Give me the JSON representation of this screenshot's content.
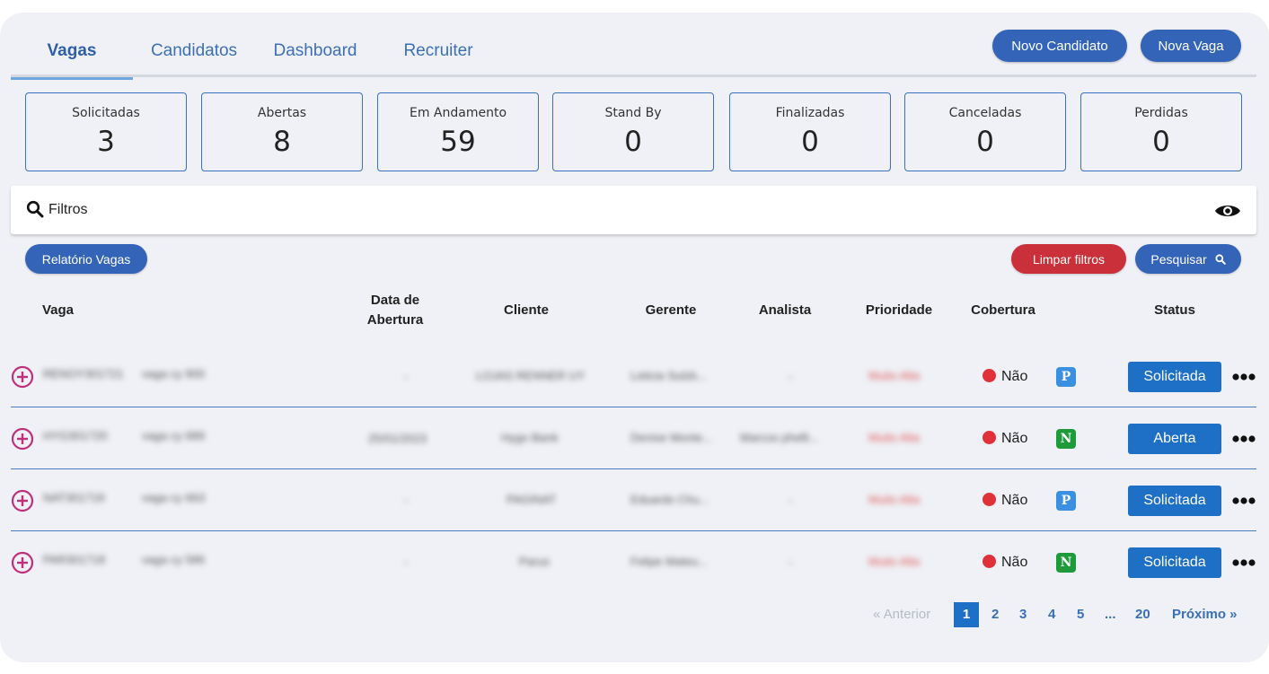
{
  "tabs": [
    {
      "label": "Vagas",
      "active": true
    },
    {
      "label": "Candidatos"
    },
    {
      "label": "Dashboard"
    },
    {
      "label": "Recruiter"
    }
  ],
  "actions": {
    "novo_candidato": "Novo Candidato",
    "nova_vaga": "Nova Vaga"
  },
  "stats": [
    {
      "label": "Solicitadas",
      "value": "3"
    },
    {
      "label": "Abertas",
      "value": "8"
    },
    {
      "label": "Em Andamento",
      "value": "59"
    },
    {
      "label": "Stand By",
      "value": "0"
    },
    {
      "label": "Finalizadas",
      "value": "0"
    },
    {
      "label": "Canceladas",
      "value": "0"
    },
    {
      "label": "Perdidas",
      "value": "0"
    }
  ],
  "filters": {
    "label": "Filtros",
    "search_icon": "search-icon",
    "toggle_icon": "eye-icon"
  },
  "buttons": {
    "relatorio": "Relatório Vagas",
    "limpar": "Limpar filtros",
    "pesquisar": "Pesquisar"
  },
  "table": {
    "headers": {
      "vaga": "Vaga",
      "data_line1": "Data de",
      "data_line2": "Abertura",
      "cliente": "Cliente",
      "gerente": "Gerente",
      "analista": "Analista",
      "prioridade": "Prioridade",
      "cobertura": "Cobertura",
      "status": "Status"
    },
    "rows": [
      {
        "code": "RENOY301721",
        "vaga": "vaga cy 900",
        "data": "-",
        "cliente": "LOJAS RENNER UY",
        "gerente": "Leticia Sulzb...",
        "analista": "-",
        "prioridade": "Muito Alta",
        "cobertura": "Não",
        "badge": "P",
        "badge_color": "#3a8fe0",
        "status": "Solicitada"
      },
      {
        "code": "HYG301720",
        "vaga": "vaga cy 689",
        "data": "25/01/2023",
        "cliente": "Hygo Bank",
        "gerente": "Denise Monte...",
        "analista": "Marcos phelli...",
        "prioridade": "Muito Alta",
        "cobertura": "Não",
        "badge": "N",
        "badge_color": "#1e9a3a",
        "status": "Aberta"
      },
      {
        "code": "NAT301719",
        "vaga": "vaga cy 663",
        "data": "-",
        "cliente": "PAGINAT",
        "gerente": "Eduardo Chu...",
        "analista": "-",
        "prioridade": "Muito Alta",
        "cobertura": "Não",
        "badge": "P",
        "badge_color": "#3a8fe0",
        "status": "Solicitada"
      },
      {
        "code": "PAR301718",
        "vaga": "vaga cy 586",
        "data": "-",
        "cliente": "Parus",
        "gerente": "Felipe Mateu...",
        "analista": "-",
        "prioridade": "Muito Alta",
        "cobertura": "Não",
        "badge": "N",
        "badge_color": "#1e9a3a",
        "status": "Solicitada"
      }
    ]
  },
  "pagination": {
    "prev": "« Anterior",
    "pages": [
      "1",
      "2",
      "3",
      "4",
      "5",
      "...",
      "20"
    ],
    "current": "1",
    "next": "Próximo »"
  },
  "colors": {
    "accent": "#3464b8",
    "status_button": "#1e6fc6",
    "danger": "#c9303a",
    "plus_icon": "#c0307a"
  }
}
